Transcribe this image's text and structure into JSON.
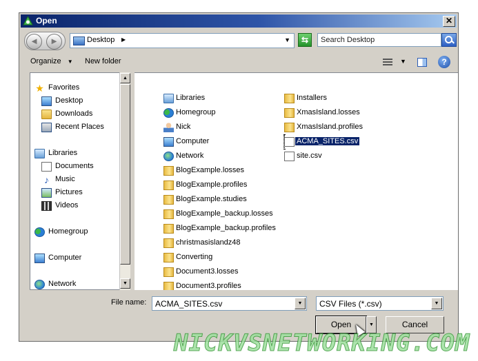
{
  "window": {
    "title": "Open",
    "close_glyph": "✕"
  },
  "nav": {
    "back_glyph": "◄",
    "forward_glyph": "►",
    "location": "Desktop",
    "loc_arrow": "▶",
    "drop_glyph": "▼",
    "refresh_glyph": "⇆"
  },
  "search": {
    "placeholder": "Search Desktop"
  },
  "toolbar": {
    "organize": "Organize",
    "organize_arrow": "▼",
    "new_folder": "New folder",
    "view_arrow": "▼",
    "help_glyph": "?"
  },
  "navpane": {
    "favorites": "Favorites",
    "desktop": "Desktop",
    "downloads": "Downloads",
    "recent": "Recent Places",
    "libraries": "Libraries",
    "documents": "Documents",
    "music": "Music",
    "pictures": "Pictures",
    "videos": "Videos",
    "homegroup": "Homegroup",
    "computer": "Computer",
    "network": "Network",
    "star_glyph": "★",
    "music_glyph": "♪",
    "scroll_up": "▲",
    "scroll_down": "▼"
  },
  "files": {
    "col1": [
      "Libraries",
      "Homegroup",
      "Nick",
      "Computer",
      "Network",
      "BlogExample.losses",
      "BlogExample.profiles",
      "BlogExample.studies",
      "BlogExample_backup.losses",
      "BlogExample_backup.profiles",
      "christmasislandz48",
      "Converting",
      "Document3.losses",
      "Document3.profiles"
    ],
    "col2": [
      "Installers",
      "XmasIsland.losses",
      "XmasIsland.profiles",
      "ACMA_SITES.csv",
      "site.csv"
    ],
    "selected": "ACMA_SITES.csv"
  },
  "bottom": {
    "file_name_label": "File name:",
    "file_name_value": "ACMA_SITES.csv",
    "file_type_value": "CSV Files (*.csv)",
    "combo_glyph": "▼",
    "open": "Open",
    "open_split": "▼",
    "cancel": "Cancel"
  },
  "watermark": "NICKVSNETWORKING.COM"
}
